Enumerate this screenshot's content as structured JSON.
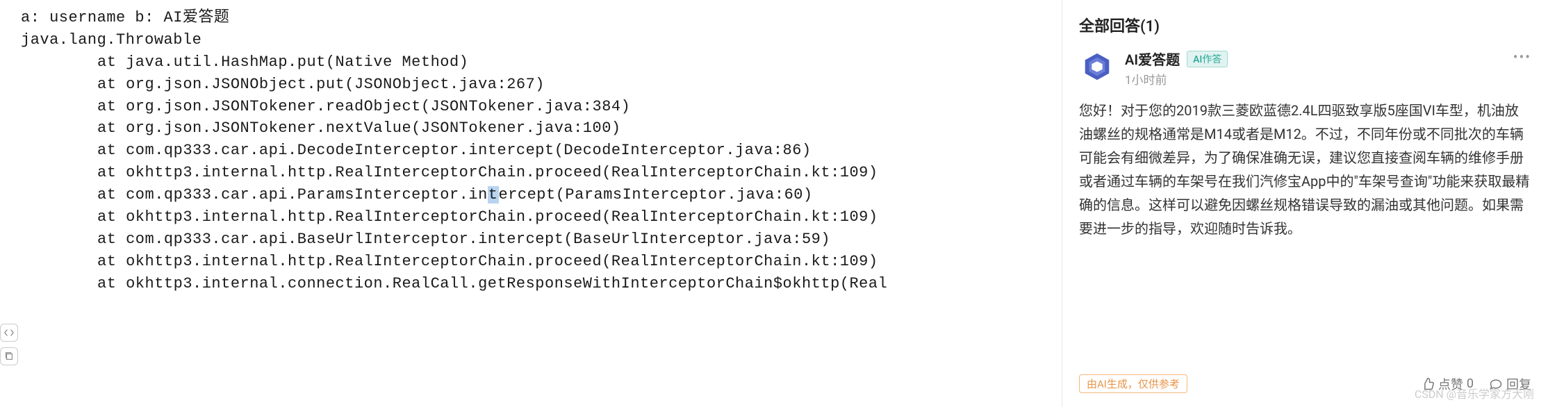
{
  "code": {
    "line1": "a: username b: AI爱答题",
    "line2": "java.lang.Throwable",
    "lines": [
      "at java.util.HashMap.put(Native Method)",
      "at org.json.JSONObject.put(JSONObject.java:267)",
      "at org.json.JSONTokener.readObject(JSONTokener.java:384)",
      "at org.json.JSONTokener.nextValue(JSONTokener.java:100)",
      "at com.qp333.car.api.DecodeInterceptor.intercept(DecodeInterceptor.java:86)",
      "at okhttp3.internal.http.RealInterceptorChain.proceed(RealInterceptorChain.kt:109)"
    ],
    "highlightPre": "at com.qp333.car.api.ParamsInterceptor.in",
    "highlightChar": "t",
    "highlightPost": "ercept(ParamsInterceptor.java:60)",
    "linesAfter": [
      "at okhttp3.internal.http.RealInterceptorChain.proceed(RealInterceptorChain.kt:109)",
      "at com.qp333.car.api.BaseUrlInterceptor.intercept(BaseUrlInterceptor.java:59)",
      "at okhttp3.internal.http.RealInterceptorChain.proceed(RealInterceptorChain.kt:109)",
      "at okhttp3.internal.connection.RealCall.getResponseWithInterceptorChain$okhttp(Real"
    ]
  },
  "sidebar": {
    "answersTitle": "全部回答(1)",
    "author": "AI爱答题",
    "aiBadge": "AI作答",
    "timestamp": "1小时前",
    "body": "您好！对于您的2019款三菱欧蓝德2.4L四驱致享版5座国VI车型，机油放油螺丝的规格通常是M14或者是M12。不过，不同年份或不同批次的车辆可能会有细微差异，为了确保准确无误，建议您直接查阅车辆的维修手册或者通过车辆的车架号在我们汽修宝App中的\"车架号查询\"功能来获取最精确的信息。这样可以避免因螺丝规格错误导致的漏油或其他问题。如果需要进一步的指导，欢迎随时告诉我。",
    "disclaimer": "由AI生成，仅供参考",
    "likeLabel": "点赞",
    "likeCount": "0",
    "replyLabel": "回复"
  },
  "watermark": "CSDN @音乐学家方大刚"
}
